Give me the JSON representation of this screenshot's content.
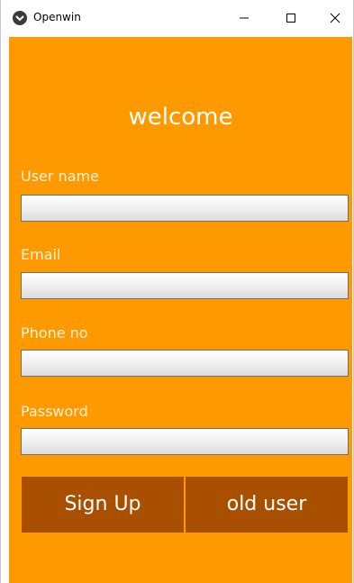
{
  "window": {
    "title": "Openwin",
    "minimize_glyph": "—",
    "maximize_glyph": "☐",
    "close_glyph": "✕",
    "icon": "app-logo-icon"
  },
  "form": {
    "heading": "welcome",
    "fields": [
      {
        "label": "User name",
        "value": "",
        "placeholder": ""
      },
      {
        "label": "Email",
        "value": "",
        "placeholder": ""
      },
      {
        "label": "Phone no",
        "value": "",
        "placeholder": ""
      },
      {
        "label": "Password",
        "value": "",
        "placeholder": ""
      }
    ],
    "signup_label": "Sign Up",
    "olduser_label": "old user"
  },
  "colors": {
    "background": "#ff9900",
    "button": "#a84f00",
    "label": "#fff1d8",
    "heading": "#ffffff"
  }
}
